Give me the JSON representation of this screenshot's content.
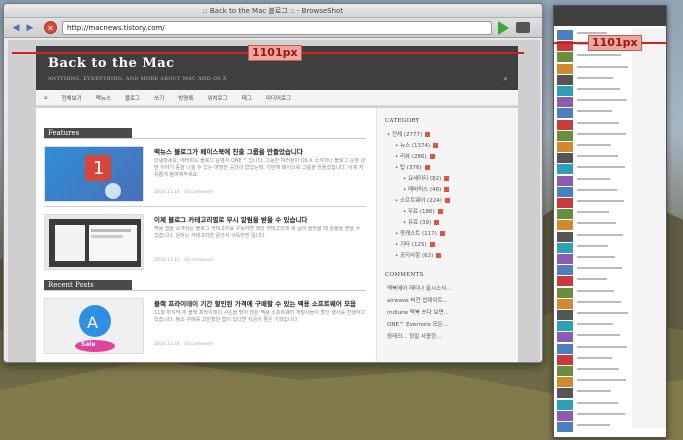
{
  "browser": {
    "window_title": ":: Back to the Mac 블로그 :: - BrowseShot",
    "url": "http://macnews.tistory.com/"
  },
  "measure": {
    "window_width_label": "1101px",
    "strip_width_label": "1101px"
  },
  "site": {
    "title": "Back to the Mac",
    "subtitle": "ANYTHING, EVERYTHING, AND MORE ABOUT MAC AND OS X",
    "menu": [
      "⌂",
      "전체보기",
      "맥뉴스",
      "블로그",
      "쓰기",
      "방명록",
      "위치로그",
      "태그",
      "미디어로그"
    ]
  },
  "featured": {
    "heading": "Features",
    "posts": [
      {
        "title": "맥뉴스 블로그가 페이스북에 진출 그룹을 만들었습니다",
        "text": "안녕하세요, 에버피드 블로그 운영자 ONE™ 입니다. 그동안 여러분이 OS X 소식이나 블로그 운영 관련 이야기 등을 나눌 수 있는 마땅한 공간이 없었는데, 이번에 페이스북 그룹을 만들었습니다. 이제 자유롭게 참여해주세요.",
        "meta": "2014.11.16 · 10 comment"
      },
      {
        "title": "이제 블로그 카테고리별로 무시 알림을 받을 수 있습니다",
        "text": "맥용 앱을 소개하는 블로그 카테고리를 구독하면 해당 카테고리에 새 글이 올라올 때 알림을 받을 수 있습니다. 원하는 카테고리만 골라서 구독하면 됩니다.",
        "meta": "2014.11.13 · 16 comment"
      }
    ]
  },
  "recent": {
    "heading": "Recent Posts",
    "posts": [
      {
        "title": "블랙 프라이데이 기간 할인된 가격에 구매할 수 있는 맥용 소프트웨어 모음",
        "text": "11월 마지막 주 블랙 프라이데이 시즌을 맞아 많은 맥용 소프트웨어 개발사들이 할인 행사를 진행하고 있습니다. 평소 구매를 고민했던 앱이 있다면 지금이 좋은 기회입니다.",
        "meta": "2014.11.28 · 10 comment",
        "badge": "Sale"
      }
    ]
  },
  "sidebar": {
    "category_heading": "CATEGORY",
    "categories": [
      {
        "label": "전체 (2777)",
        "level": 0
      },
      {
        "label": "뉴스 (1374)",
        "level": 1
      },
      {
        "label": "리뷰 (286)",
        "level": 1
      },
      {
        "label": "팁 (376)",
        "level": 1
      },
      {
        "label": "요세미티 (82)",
        "level": 2
      },
      {
        "label": "매버릭스 (48)",
        "level": 2
      },
      {
        "label": "소프트웨어 (224)",
        "level": 1
      },
      {
        "label": "무료 (186)",
        "level": 2
      },
      {
        "label": "유료 (39)",
        "level": 2
      },
      {
        "label": "팟캐스트 (117)",
        "level": 1
      },
      {
        "label": "기타 (125)",
        "level": 1
      },
      {
        "label": "공지사항 (62)",
        "level": 1
      }
    ],
    "comments_heading": "COMMENTS",
    "comments": [
      "맥북에어 레티나 출시소식...",
      "airwave 버전 업데이트...",
      "rndlune 맥북 쓰다 보면...",
      "ONE™ Evernote 모든...",
      "원래의... 정말 사용한..."
    ]
  }
}
